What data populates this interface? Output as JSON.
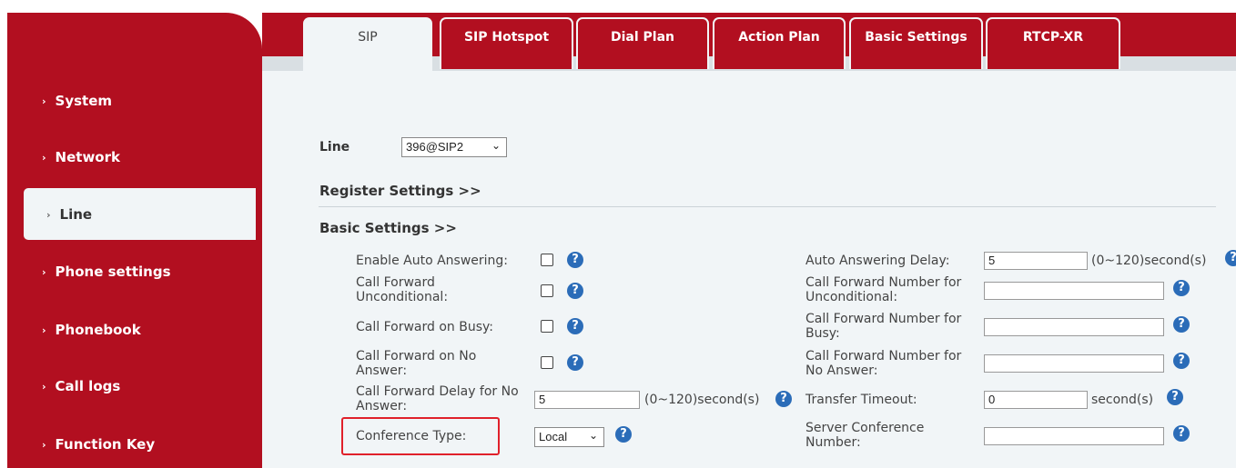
{
  "sidebar": {
    "items": [
      {
        "label": "System"
      },
      {
        "label": "Network"
      },
      {
        "label": "Line"
      },
      {
        "label": "Phone settings"
      },
      {
        "label": "Phonebook"
      },
      {
        "label": "Call logs"
      },
      {
        "label": "Function Key"
      }
    ]
  },
  "tabs": [
    {
      "label": "SIP"
    },
    {
      "label": "SIP Hotspot"
    },
    {
      "label": "Dial Plan"
    },
    {
      "label": "Action Plan"
    },
    {
      "label": "Basic Settings"
    },
    {
      "label": "RTCP-XR"
    }
  ],
  "content": {
    "line_label": "Line",
    "line_value": "396@SIP2",
    "register_settings": "Register Settings >>",
    "basic_settings": "Basic Settings >>",
    "help_glyph": "?",
    "left": {
      "enable_auto_answering": "Enable Auto Answering:",
      "cf_unconditional_1": "Call Forward",
      "cf_unconditional_2": "Unconditional:",
      "cf_busy": "Call Forward on Busy:",
      "cf_no_answer_1": "Call Forward on No",
      "cf_no_answer_2": "Answer:",
      "cf_delay_1": "Call Forward Delay for No",
      "cf_delay_2": "Answer:",
      "cf_delay_value": "5",
      "cf_delay_unit": "(0~120)second(s)",
      "conference_type": "Conference Type:",
      "conference_value": "Local"
    },
    "right": {
      "auto_answer_delay": "Auto Answering Delay:",
      "auto_answer_delay_value": "5",
      "auto_answer_delay_unit": "(0~120)second(s)",
      "cfn_unconditional_1": "Call Forward Number for",
      "cfn_unconditional_2": "Unconditional:",
      "cfn_busy_1": "Call Forward Number for",
      "cfn_busy_2": "Busy:",
      "cfn_no_answer_1": "Call Forward Number for",
      "cfn_no_answer_2": "No Answer:",
      "transfer_timeout": "Transfer Timeout:",
      "transfer_timeout_value": "0",
      "transfer_timeout_unit": "second(s)",
      "server_conf_1": "Server Conference",
      "server_conf_2": "Number:"
    }
  },
  "colors": {
    "brand_red": "#b20f20",
    "panel_bg": "#f1f5f7",
    "help_blue": "#2b6cb8",
    "highlight": "#e0202a"
  }
}
